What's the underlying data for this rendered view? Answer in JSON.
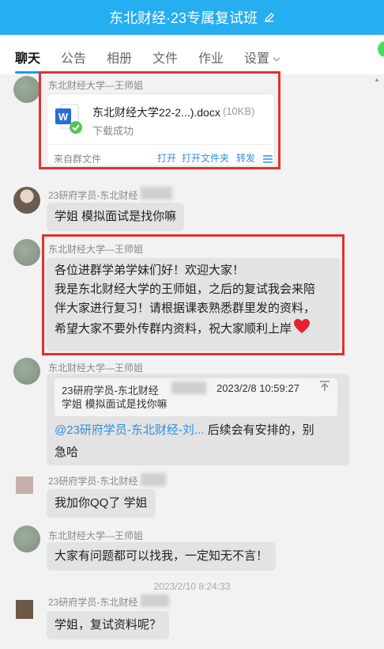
{
  "header": {
    "title": "东北财经·23专属复试班"
  },
  "tabs": [
    {
      "label": "聊天"
    },
    {
      "label": "公告"
    },
    {
      "label": "相册"
    },
    {
      "label": "文件"
    },
    {
      "label": "作业"
    },
    {
      "label": "设置"
    }
  ],
  "messages": {
    "m1": {
      "sender": "东北财经大学—王师姐",
      "file": {
        "name": "东北财经大学22-2...).docx",
        "size": "(10KB)",
        "status": "下载成功",
        "source": "来自群文件",
        "actions": {
          "open": "打开",
          "open_folder": "打开文件夹",
          "forward": "转发"
        }
      }
    },
    "m2": {
      "sender": "23研府学员-东北财经",
      "text": "学姐 模拟面试是找你嘛"
    },
    "m3": {
      "sender": "东北财经大学—王师姐",
      "lines": [
        "各位进群学弟学妹们好！欢迎大家！",
        "我是东北财经大学的王师姐，之后的复试我会来陪",
        "伴大家进行复习！请根据课表熟悉群里发的资料，",
        "希望大家不要外传群内资料，祝大家顺利上岸"
      ]
    },
    "m4": {
      "sender": "东北财经大学—王师姐",
      "quote": {
        "name": "23研府学员-东北财经",
        "time": "2023/2/8 10:59:27",
        "text": "学姐 模拟面试是找你嘛"
      },
      "mention": "@23研府学员-东北财经-刘...",
      "text_after": "后续会有安排的，别",
      "text_line2": "急哈"
    },
    "m5": {
      "sender": "23研府学员-东北财经",
      "text": "我加你QQ了 学姐"
    },
    "m6": {
      "sender": "东北财经大学—王师姐",
      "text": "大家有问题都可以找我，一定知无不言！"
    },
    "timestamp": "2023/2/10 8:24:33",
    "m7": {
      "sender": "23研府学员-东北财经",
      "text": "学姐，复试资料呢？"
    }
  },
  "colors": {
    "header": "#25aef0",
    "link": "#2f8ede",
    "highlight_box": "#e53030",
    "bubble": "#e3e3e3"
  }
}
